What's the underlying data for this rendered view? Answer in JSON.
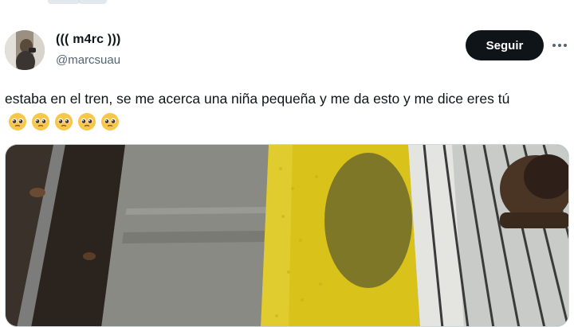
{
  "tweet": {
    "display_name": "((( m4rc )))",
    "handle": "@marcsuau",
    "follow_label": "Seguir",
    "text": "estaba en el tren, se me acerca una niña pequeña y me da esto y me dice eres tú",
    "emojis": [
      "pleading-face",
      "pleading-face",
      "pleading-face",
      "pleading-face",
      "pleading-face"
    ]
  },
  "colors": {
    "text_primary": "#0f1419",
    "text_secondary": "#536471",
    "button_bg": "#0f1419",
    "button_text": "#ffffff",
    "tactile_strip": "#d9c21a",
    "platform_gray": "#8a8a84"
  },
  "icons": {
    "more": "more-horizontal-icon",
    "emoji": "pleading-face-icon"
  }
}
